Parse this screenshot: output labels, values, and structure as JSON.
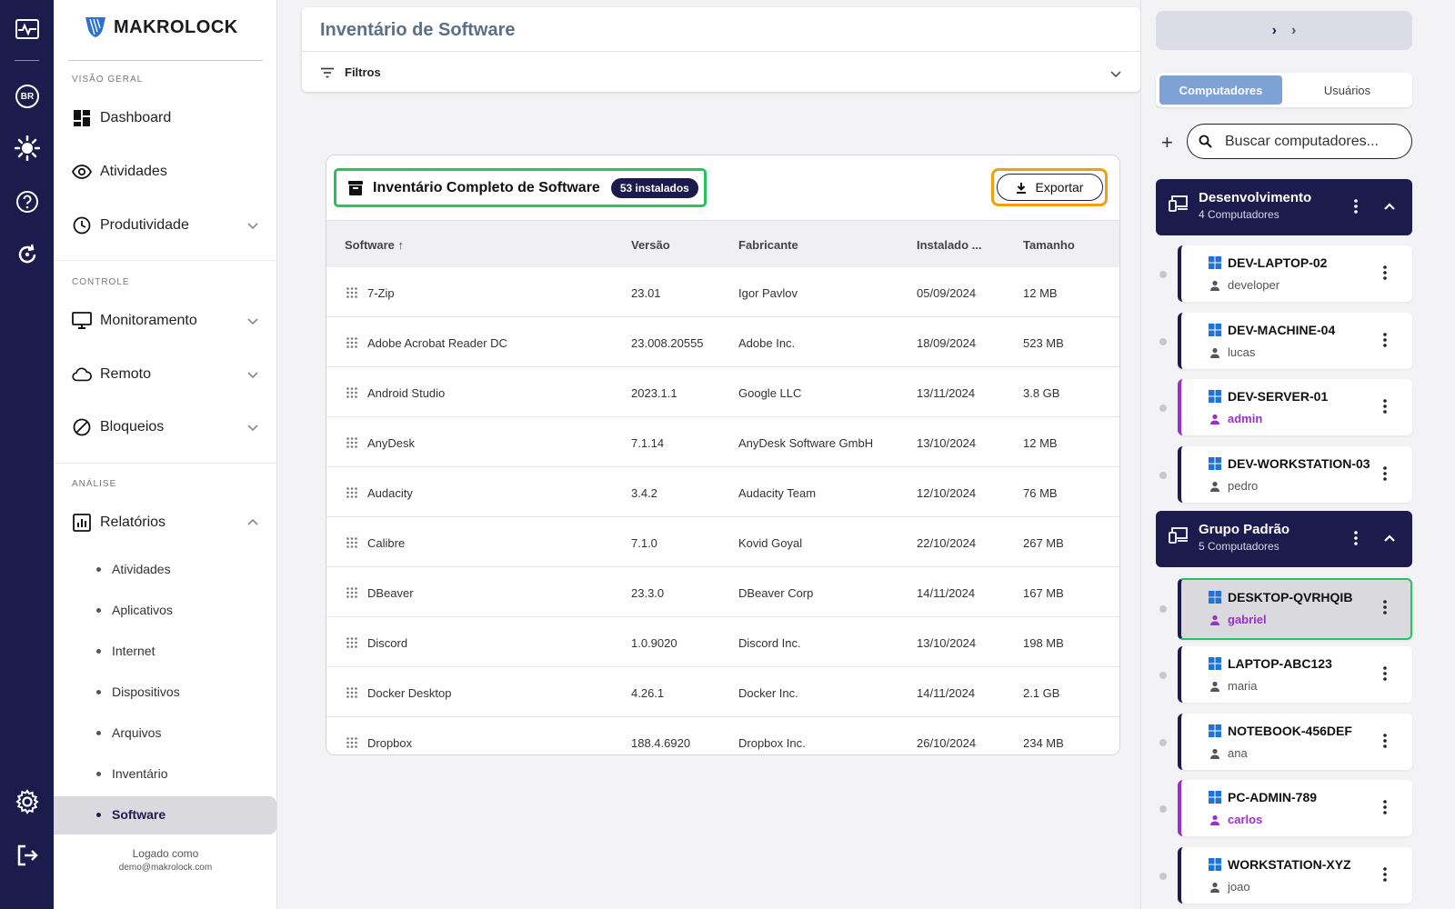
{
  "rail": {
    "language": "BR"
  },
  "sidebar": {
    "logo_text": "MAKROLOCK",
    "section_overview": "VISÃO GERAL",
    "section_control": "CONTROLE",
    "section_analysis": "ANÁLISE",
    "nav": {
      "dashboard": "Dashboard",
      "atividades": "Atividades",
      "produtividade": "Produtividade",
      "monitoramento": "Monitoramento",
      "remoto": "Remoto",
      "bloqueios": "Bloqueios",
      "relatorios": "Relatórios"
    },
    "reports_sub": [
      "Atividades",
      "Aplicativos",
      "Internet",
      "Dispositivos",
      "Arquivos",
      "Inventário",
      "Software"
    ],
    "logged_label": "Logado como",
    "logged_email": "demo@makrolock.com"
  },
  "header": {
    "title": "Inventário de Software",
    "filters_label": "Filtros"
  },
  "inventory": {
    "title": "Inventário Completo de Software",
    "badge": "53 instalados",
    "export_label": "Exportar",
    "columns": {
      "software": "Software",
      "version": "Versão",
      "vendor": "Fabricante",
      "installed": "Instalado ...",
      "size": "Tamanho"
    },
    "rows": [
      {
        "name": "7-Zip",
        "version": "23.01",
        "vendor": "Igor Pavlov",
        "installed": "05/09/2024",
        "size": "12 MB"
      },
      {
        "name": "Adobe Acrobat Reader DC",
        "version": "23.008.20555",
        "vendor": "Adobe Inc.",
        "installed": "18/09/2024",
        "size": "523 MB"
      },
      {
        "name": "Android Studio",
        "version": "2023.1.1",
        "vendor": "Google LLC",
        "installed": "13/11/2024",
        "size": "3.8 GB"
      },
      {
        "name": "AnyDesk",
        "version": "7.1.14",
        "vendor": "AnyDesk Software GmbH",
        "installed": "13/10/2024",
        "size": "12 MB"
      },
      {
        "name": "Audacity",
        "version": "3.4.2",
        "vendor": "Audacity Team",
        "installed": "12/10/2024",
        "size": "76 MB"
      },
      {
        "name": "Calibre",
        "version": "7.1.0",
        "vendor": "Kovid Goyal",
        "installed": "22/10/2024",
        "size": "267 MB"
      },
      {
        "name": "DBeaver",
        "version": "23.3.0",
        "vendor": "DBeaver Corp",
        "installed": "14/11/2024",
        "size": "167 MB"
      },
      {
        "name": "Discord",
        "version": "1.0.9020",
        "vendor": "Discord Inc.",
        "installed": "13/10/2024",
        "size": "198 MB"
      },
      {
        "name": "Docker Desktop",
        "version": "4.26.1",
        "vendor": "Docker Inc.",
        "installed": "14/11/2024",
        "size": "2.1 GB"
      },
      {
        "name": "Dropbox",
        "version": "188.4.6920",
        "vendor": "Dropbox Inc.",
        "installed": "26/10/2024",
        "size": "234 MB"
      }
    ]
  },
  "right": {
    "tab_computers": "Computadores",
    "tab_users": "Usuários",
    "search_placeholder": "Buscar computadores...",
    "groups": [
      {
        "name": "Desenvolvimento",
        "count": "4 Computadores"
      },
      {
        "name": "Grupo Padrão",
        "count": "5 Computadores"
      }
    ],
    "computers": [
      {
        "name": "DEV-LAPTOP-02",
        "user": "developer"
      },
      {
        "name": "DEV-MACHINE-04",
        "user": "lucas"
      },
      {
        "name": "DEV-SERVER-01",
        "user": "admin"
      },
      {
        "name": "DEV-WORKSTATION-03",
        "user": "pedro"
      },
      {
        "name": "DESKTOP-QVRHQIB",
        "user": "gabriel"
      },
      {
        "name": "LAPTOP-ABC123",
        "user": "maria"
      },
      {
        "name": "NOTEBOOK-456DEF",
        "user": "ana"
      },
      {
        "name": "PC-ADMIN-789",
        "user": "carlos"
      },
      {
        "name": "WORKSTATION-XYZ",
        "user": "joao"
      }
    ]
  }
}
